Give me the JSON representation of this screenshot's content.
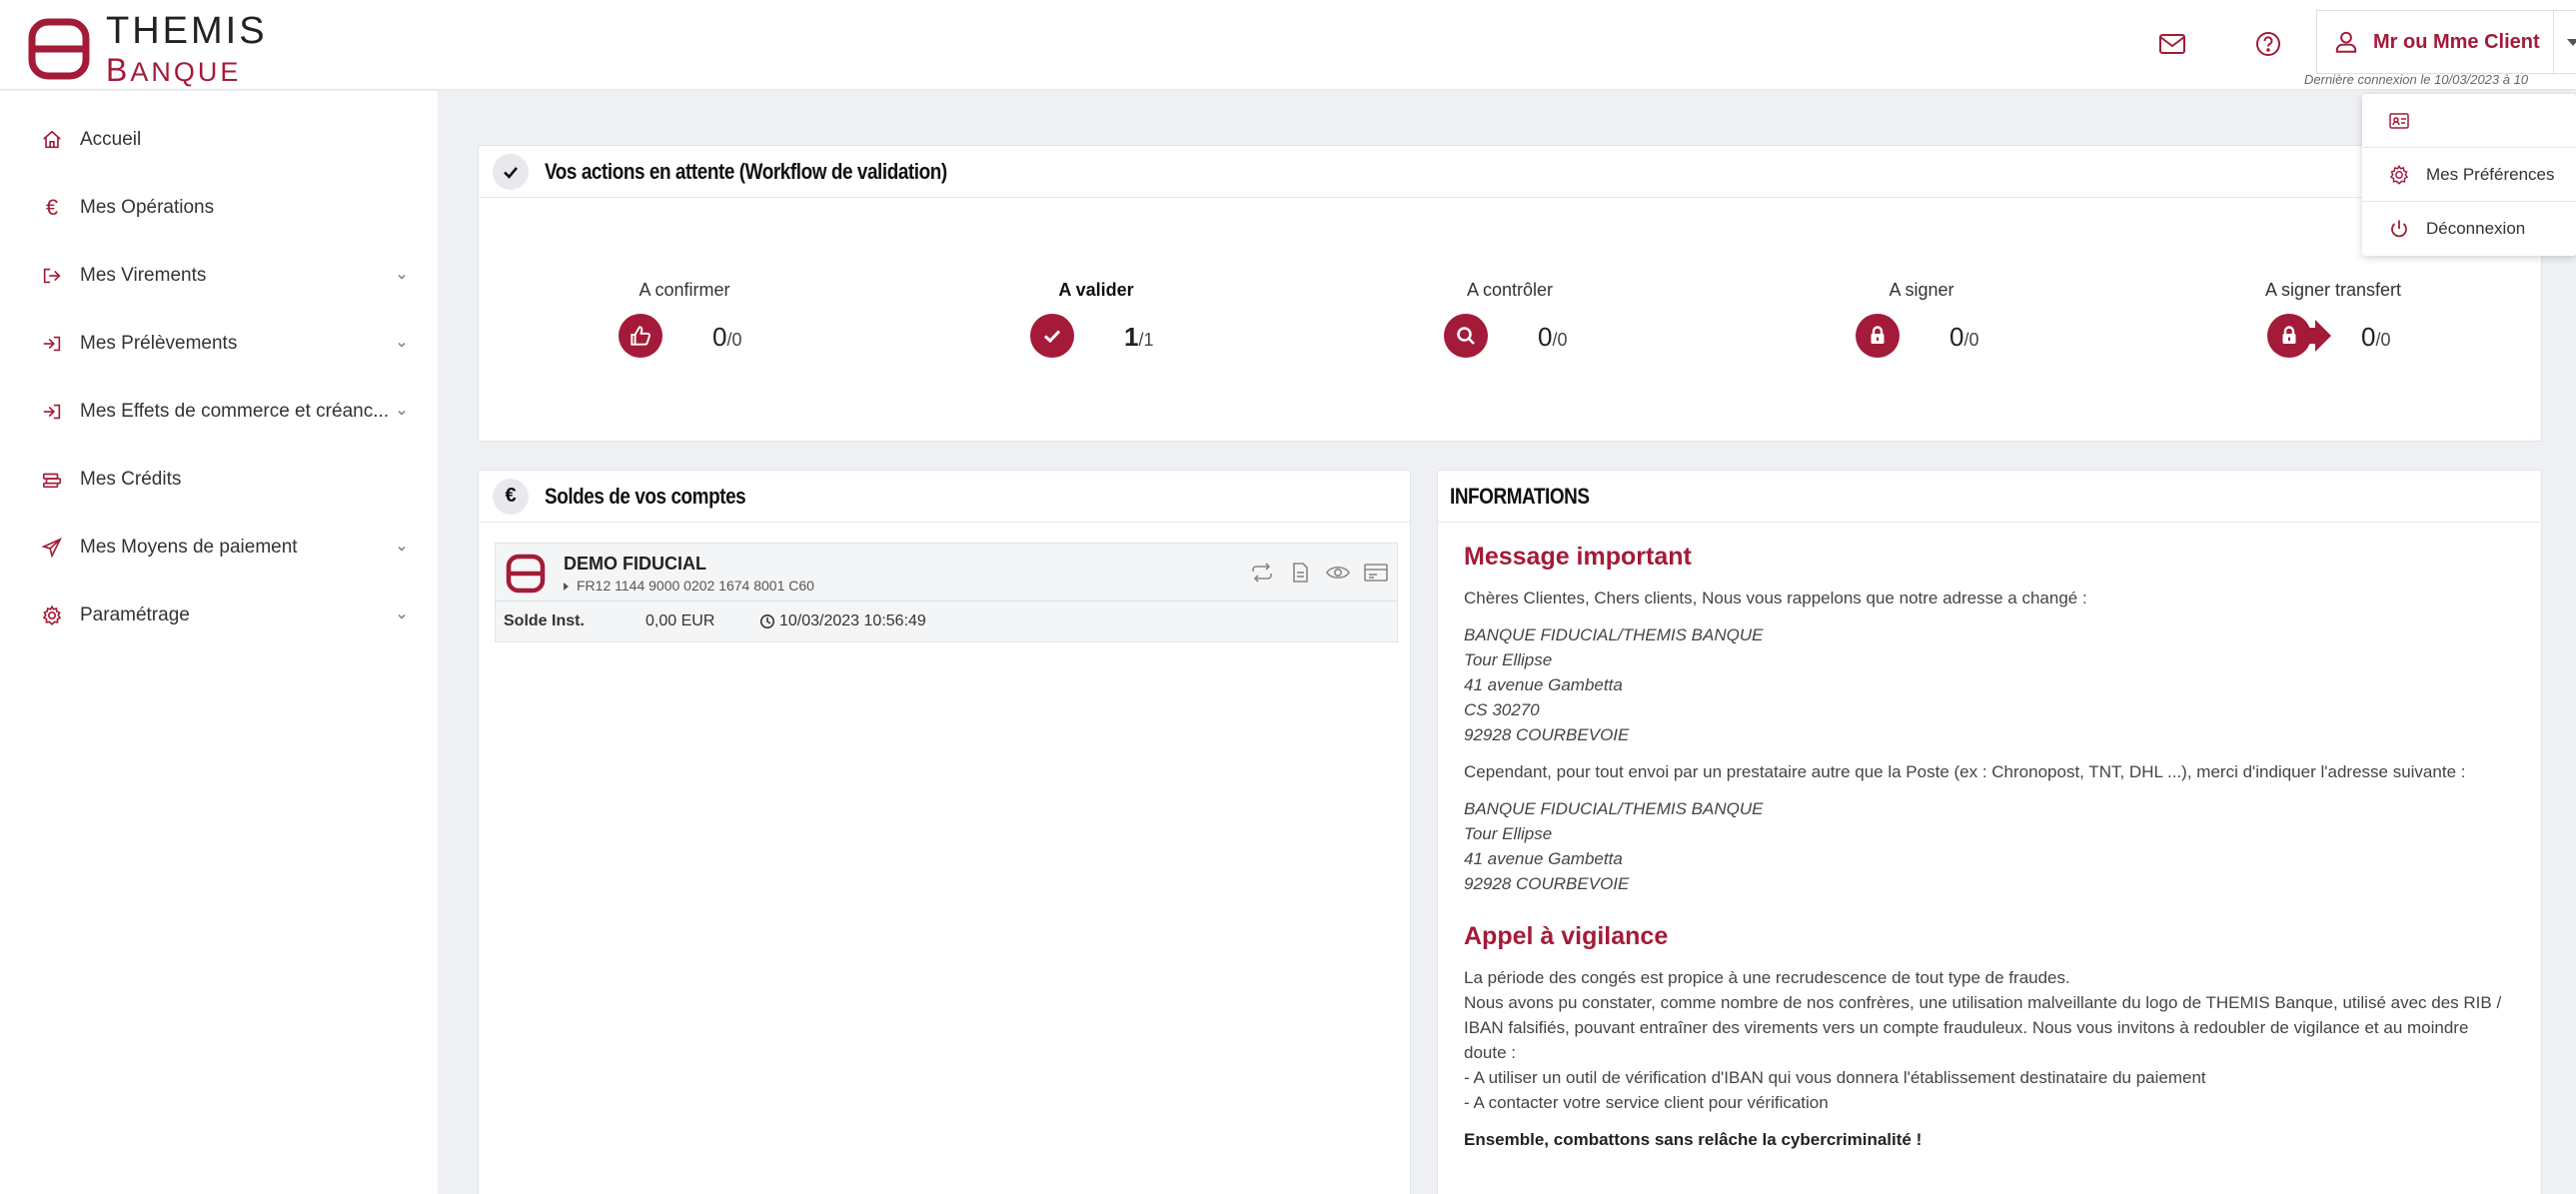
{
  "brand": {
    "title": "THEMIS",
    "subtitle": "BANQUE"
  },
  "header": {
    "user_name": "Mr ou Mme Client",
    "last_login": "Dernière connexion le 10/03/2023 à 10"
  },
  "user_menu": {
    "items": [
      {
        "label": "",
        "icon": "id-card-icon"
      },
      {
        "label": "Mes Préférences",
        "icon": "gear-icon"
      },
      {
        "label": "Déconnexion",
        "icon": "power-icon"
      }
    ]
  },
  "sidebar": {
    "items": [
      {
        "label": "Accueil",
        "icon": "home-icon",
        "has_children": false
      },
      {
        "label": "Mes Opérations",
        "icon": "euro-icon",
        "has_children": false
      },
      {
        "label": "Mes Virements",
        "icon": "transfer-out-icon",
        "has_children": true
      },
      {
        "label": "Mes Prélèvements",
        "icon": "transfer-in-icon",
        "has_children": true
      },
      {
        "label": "Mes Effets de commerce et créanc...",
        "icon": "transfer-in-icon",
        "has_children": true
      },
      {
        "label": "Mes Crédits",
        "icon": "coins-icon",
        "has_children": false
      },
      {
        "label": "Mes Moyens de paiement",
        "icon": "paper-plane-icon",
        "has_children": true
      },
      {
        "label": "Paramétrage",
        "icon": "gear-icon",
        "has_children": true
      }
    ]
  },
  "pending": {
    "title": "Vos actions en attente (Workflow de validation)",
    "actions": [
      {
        "label": "A confirmer",
        "current": "0",
        "total": "/0",
        "icon": "thumbs-up-icon",
        "bold": false
      },
      {
        "label": "A valider",
        "current": "1",
        "total": "/1",
        "icon": "check-icon",
        "bold": true
      },
      {
        "label": "A contrôler",
        "current": "0",
        "total": "/0",
        "icon": "magnifier-icon",
        "bold": false
      },
      {
        "label": "A signer",
        "current": "0",
        "total": "/0",
        "icon": "lock-icon",
        "bold": false
      },
      {
        "label": "A signer transfert",
        "current": "0",
        "total": "/0",
        "icon": "lock-arrow-icon",
        "bold": false
      }
    ]
  },
  "balances": {
    "title": "Soldes de vos comptes",
    "account": {
      "name": "DEMO FIDUCIAL",
      "iban": "FR12 1144 9000 0202 1674 8001 C60",
      "balance_label": "Solde Inst.",
      "balance_value": "0,00 EUR",
      "timestamp": "10/03/2023 10:56:49"
    }
  },
  "info": {
    "title": "INFORMATIONS",
    "msg1_title": "Message important",
    "msg1_intro": "Chères Clientes, Chers clients, Nous vous rappelons que notre adresse a changé :",
    "addr1": [
      "BANQUE FIDUCIAL/THEMIS BANQUE",
      "Tour Ellipse",
      "41 avenue Gambetta",
      "CS 30270",
      "92928 COURBEVOIE"
    ],
    "msg1_mid": "Cependant, pour tout envoi par un prestataire autre que la Poste (ex : Chronopost, TNT, DHL ...), merci d'indiquer l'adresse suivante :",
    "addr2": [
      "BANQUE FIDUCIAL/THEMIS BANQUE",
      "Tour Ellipse",
      "41 avenue Gambetta",
      "92928 COURBEVOIE"
    ],
    "msg2_title": "Appel à vigilance",
    "msg2_lines": [
      "La période des congés est propice à une recrudescence de tout type de fraudes.",
      "Nous avons pu constater, comme nombre de nos confrères, une utilisation malveillante du logo de THEMIS Banque, utilisé avec des RIB / IBAN falsifiés, pouvant entraîner des virements vers un compte frauduleux. Nous vous invitons à redoubler de vigilance et au moindre doute :",
      "- A utiliser un outil de vérification d'IBAN qui vous donnera l'établissement destinataire du paiement",
      "- A contacter votre service client pour vérification"
    ],
    "msg2_closing": "Ensemble, combattons sans relâche la cybercriminalité !"
  },
  "colors": {
    "brand": "#a31b38",
    "background": "#eef0f3"
  }
}
